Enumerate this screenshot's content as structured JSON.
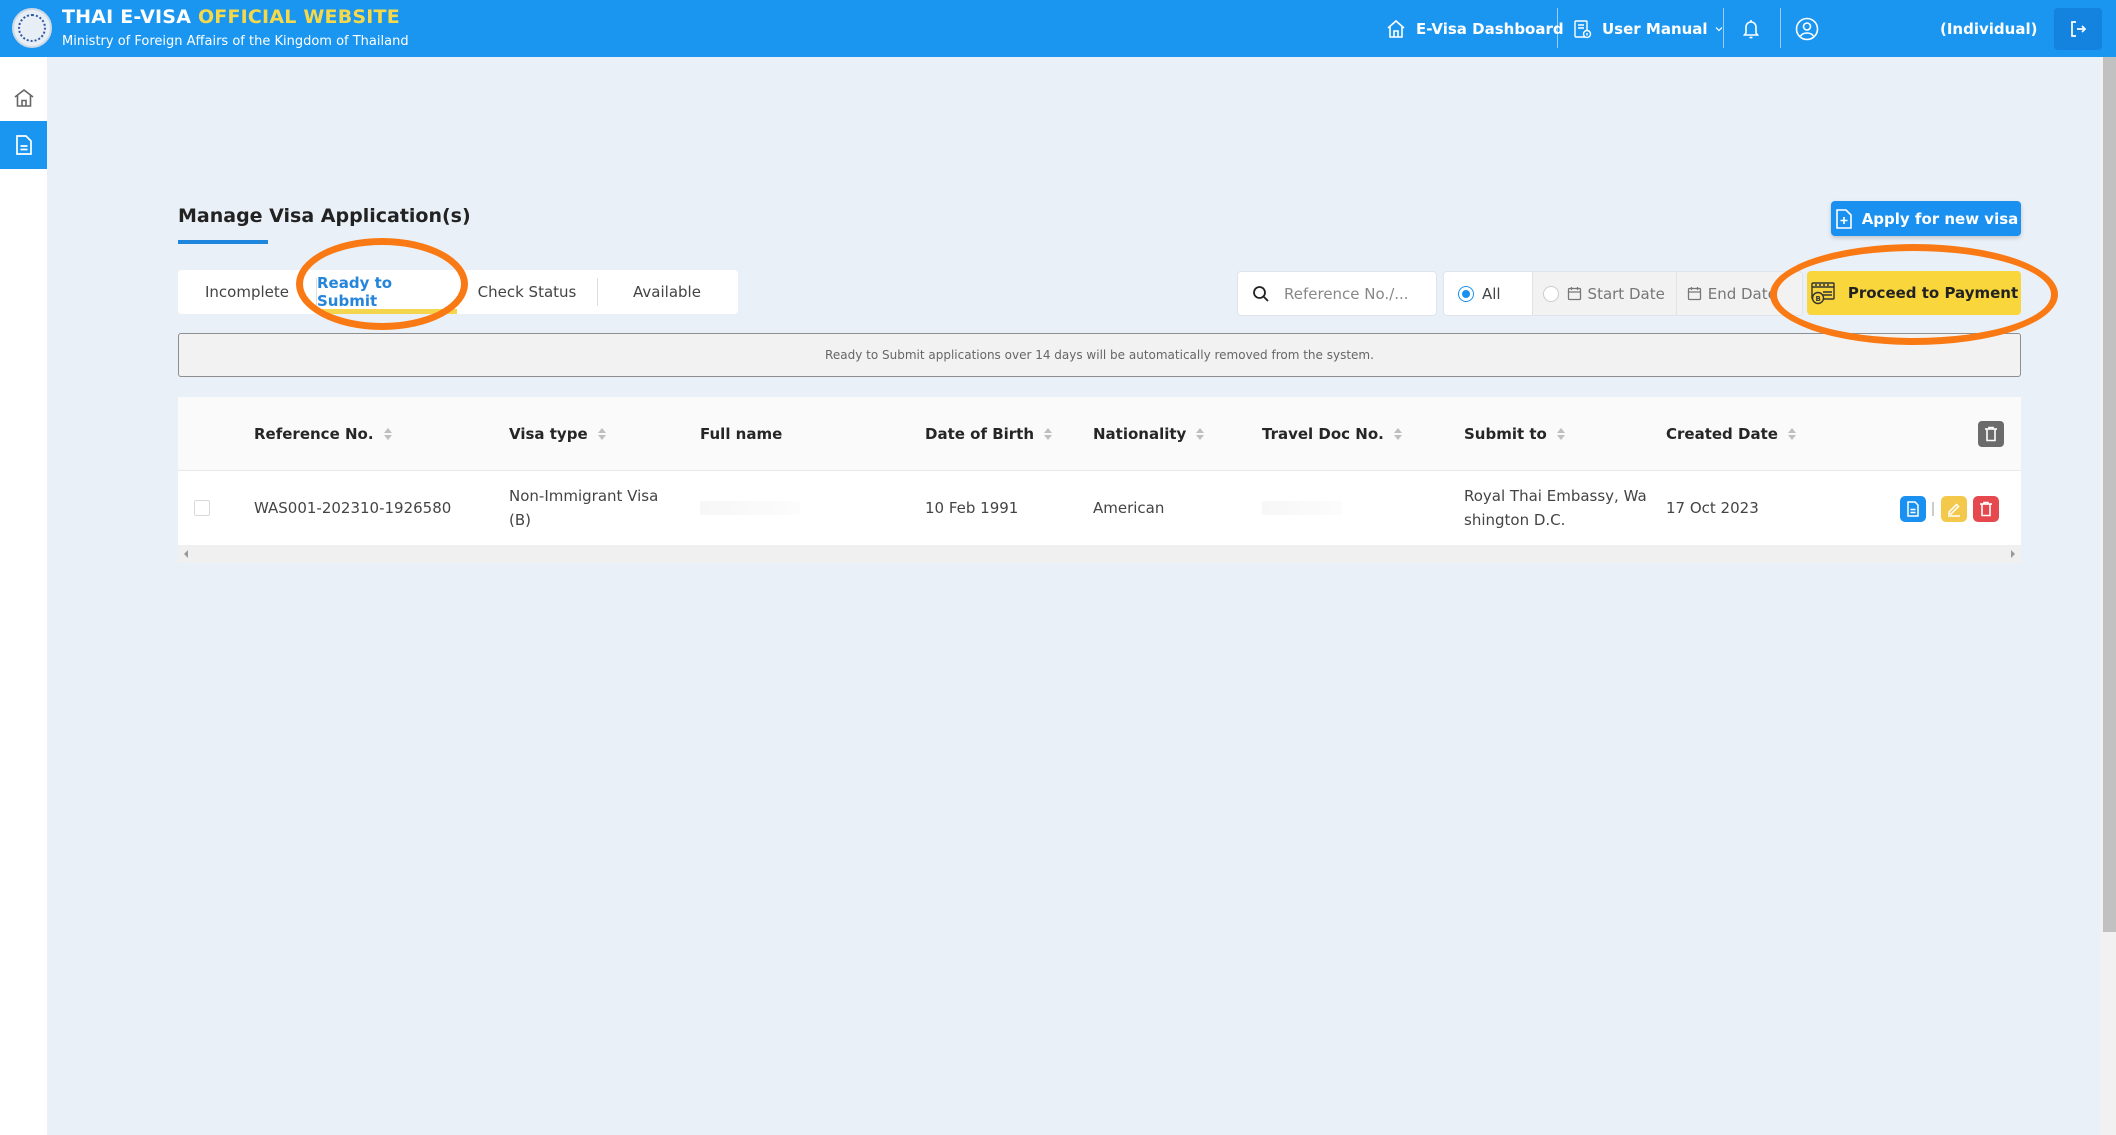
{
  "header": {
    "brand_main": "THAI E-VISA",
    "brand_accent": "OFFICIAL WEBSITE",
    "brand_sub": "Ministry of Foreign Affairs of the Kingdom of Thailand",
    "nav": {
      "dashboard": "E-Visa Dashboard",
      "user_manual": "User Manual",
      "account_type": "(Individual)"
    },
    "icons": {
      "logo": "ministry-seal",
      "dashboard": "home-icon",
      "manual": "book-icon",
      "notifications": "bell-icon",
      "profile": "user-circle-icon",
      "logout": "logout-icon"
    }
  },
  "sidebar": {
    "items": [
      {
        "icon": "home-icon",
        "active": false
      },
      {
        "icon": "document-icon",
        "active": true
      }
    ]
  },
  "page": {
    "title": "Manage Visa Application(s)",
    "apply_button": "Apply for new visa",
    "tabs": [
      {
        "label": "Incomplete",
        "active": false
      },
      {
        "label": "Ready to Submit",
        "active": true
      },
      {
        "label": "Check Status",
        "active": false
      },
      {
        "label": "Available",
        "active": false
      }
    ],
    "filters": {
      "search_placeholder": "Reference No./...",
      "search_value": "",
      "date_mode_options": [
        "All",
        "Start Date",
        "End Date"
      ],
      "date_mode_selected": "All",
      "start_date_label": "Start Date",
      "end_date_label": "End Date"
    },
    "proceed_button": "Proceed to Payment",
    "notice": "Ready to Submit applications over 14 days will be automatically removed from the system."
  },
  "table": {
    "columns": [
      {
        "label": "Reference No.",
        "sortable": true
      },
      {
        "label": "Visa type",
        "sortable": true
      },
      {
        "label": "Full name",
        "sortable": false
      },
      {
        "label": "Date of Birth",
        "sortable": true
      },
      {
        "label": "Nationality",
        "sortable": true
      },
      {
        "label": "Travel Doc No.",
        "sortable": true
      },
      {
        "label": "Submit to",
        "sortable": true
      },
      {
        "label": "Created Date",
        "sortable": true
      }
    ],
    "rows": [
      {
        "checked": false,
        "reference_no": "WAS001-202310-1926580",
        "visa_type_line1": "Non-Immigrant Visa",
        "visa_type_line2": "(B)",
        "full_name": "",
        "date_of_birth": "10 Feb 1991",
        "nationality": "American",
        "travel_doc_no": "",
        "submit_to_line1": "Royal Thai Embassy, Wa",
        "submit_to_line2": "shington D.C.",
        "created_date": "17 Oct 2023"
      }
    ]
  },
  "annotations": [
    {
      "target": "tab-ready-to-submit",
      "color": "#f97a14"
    },
    {
      "target": "proceed-to-payment-button",
      "color": "#f97a14"
    }
  ],
  "colors": {
    "header_blue": "#1a96f0",
    "accent_yellow": "#f8d63c",
    "active_tab_text": "#2485db",
    "delete_red": "#e5484d",
    "annotation_orange": "#f97a14"
  }
}
